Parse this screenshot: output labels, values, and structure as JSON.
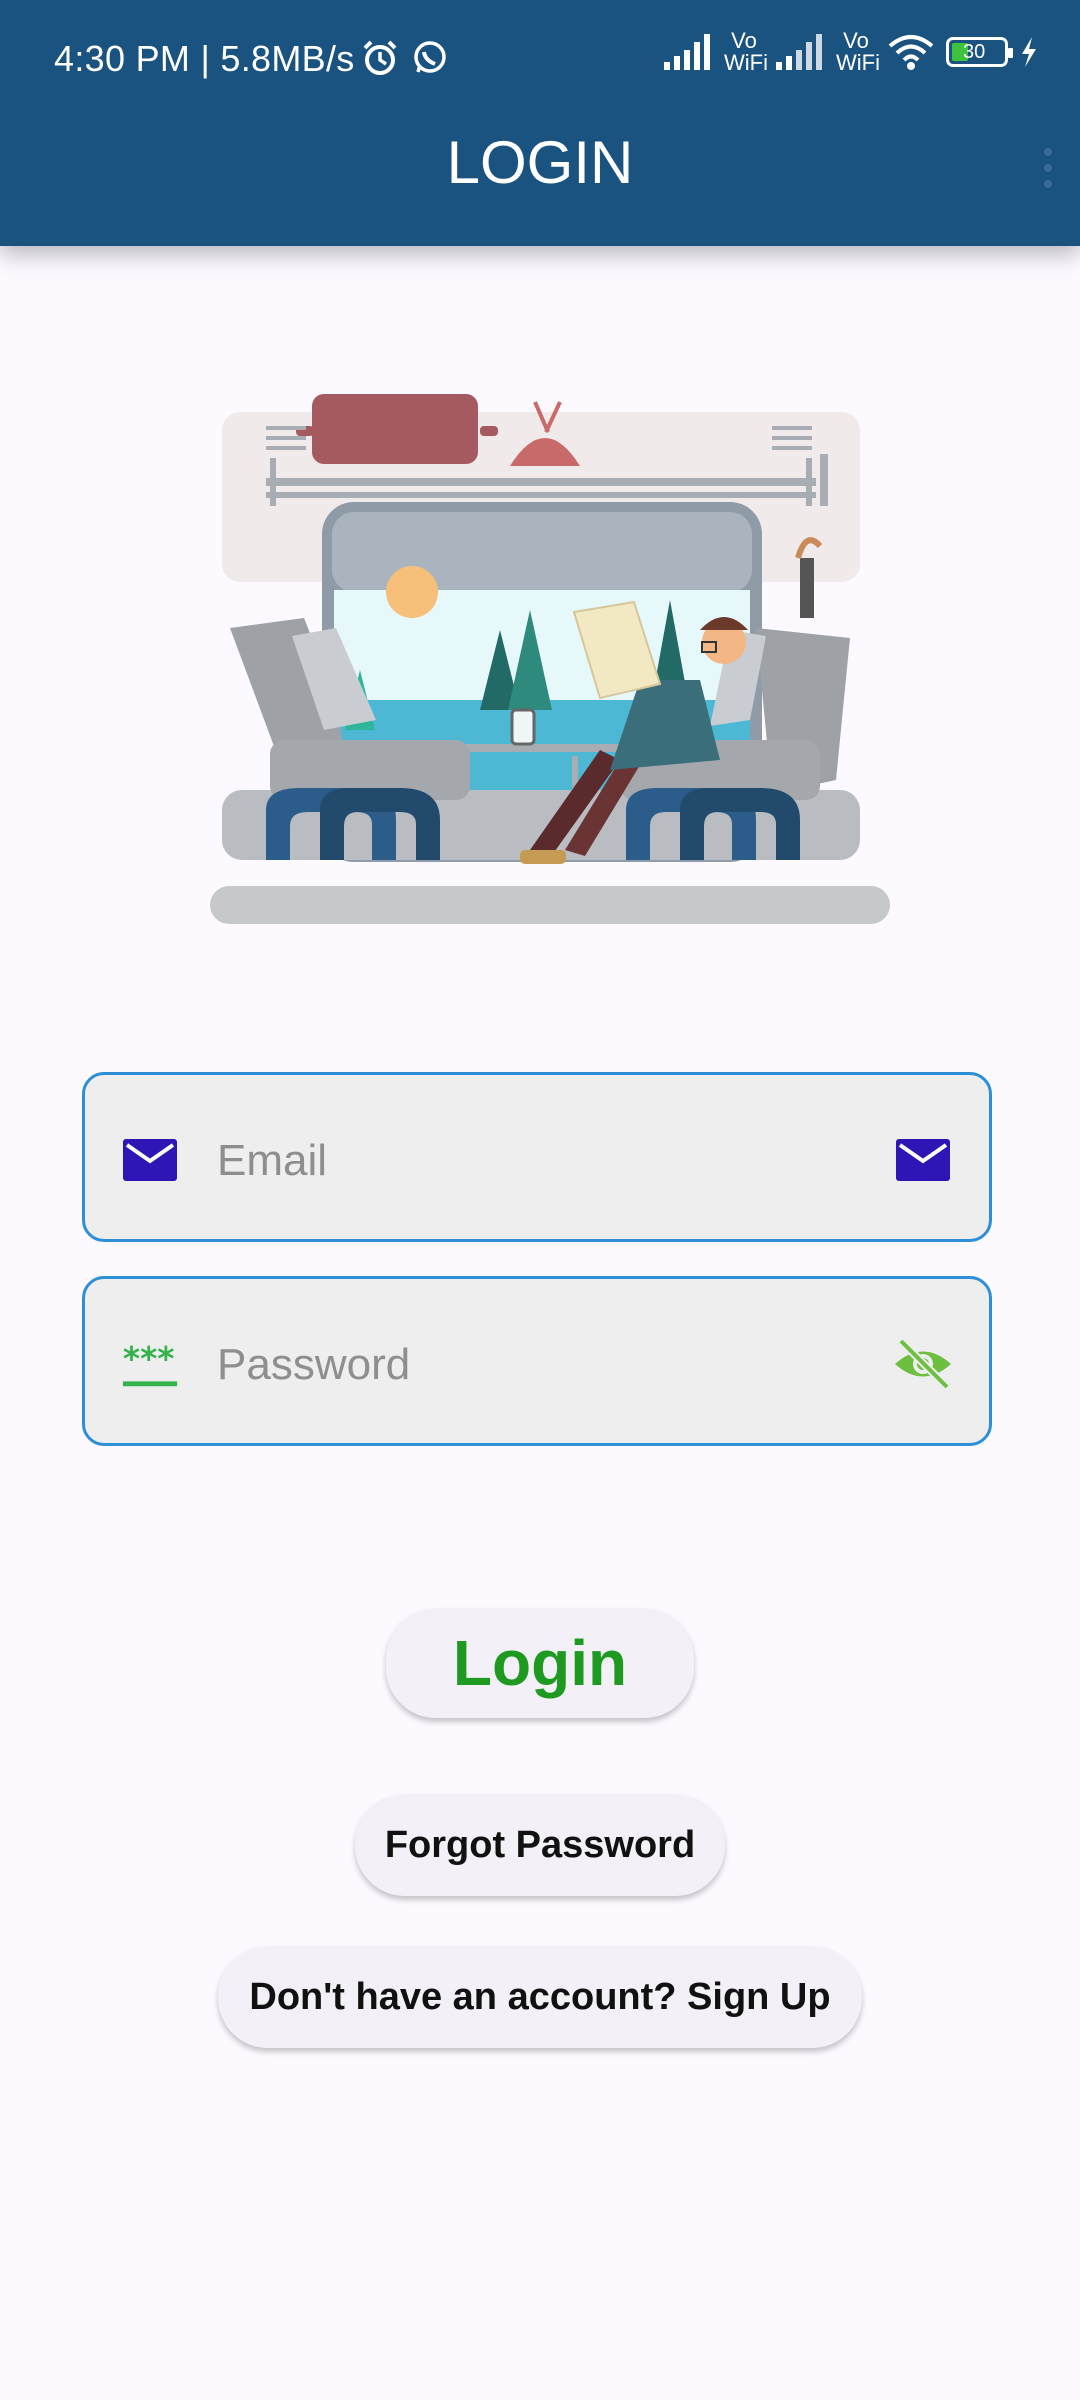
{
  "status_bar": {
    "time_speed": "4:30 PM | 5.8MB/s",
    "vowifi_1": "Vo WiFi",
    "vowifi_2": "Vo WiFi",
    "battery": "30"
  },
  "app_bar": {
    "title": "LOGIN"
  },
  "form": {
    "email": {
      "placeholder": "Email",
      "value": "",
      "icon": "mail-icon"
    },
    "password": {
      "placeholder": "Password",
      "value": "",
      "icon": "password-icon",
      "toggle_icon": "eye-off-icon"
    }
  },
  "buttons": {
    "login": "Login",
    "forgot": "Forgot Password",
    "signup": "Don't have an account? Sign Up"
  },
  "colors": {
    "app_bar": "#1a5280",
    "field_border": "#2d8fd6",
    "mail_icon": "#2d16b5",
    "password_icon": "#34b34a",
    "eye_icon": "#6cbf3f",
    "login_text": "#1f9a20"
  }
}
